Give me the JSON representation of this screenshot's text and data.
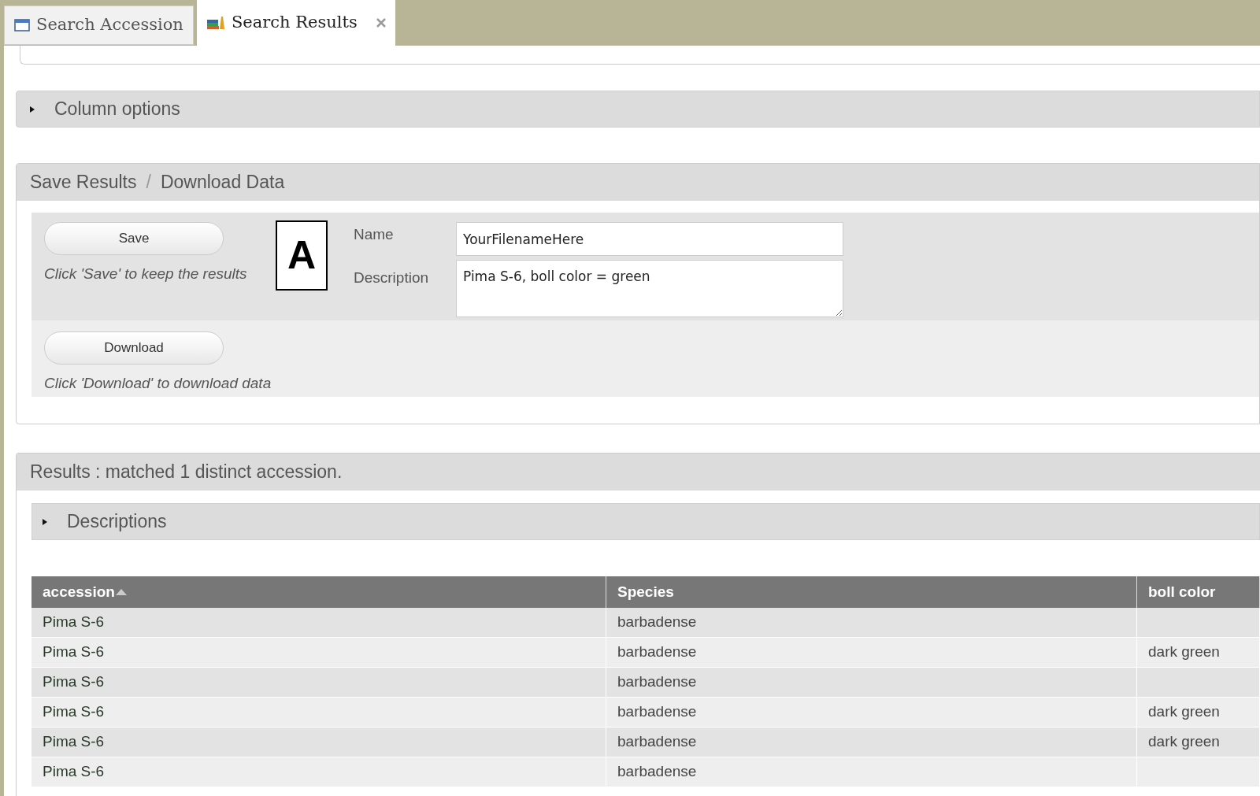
{
  "tabs": [
    {
      "label": "Search Accession",
      "kind": "window",
      "selected": false,
      "closable": false
    },
    {
      "label": "Search Results",
      "kind": "books",
      "selected": true,
      "closable": true
    }
  ],
  "column_options": {
    "title": "Column options",
    "expanded": false
  },
  "save_panel": {
    "title_parts": [
      "Save Results",
      "/",
      "Download Data"
    ],
    "save_button": "Save",
    "save_hint": "Click 'Save' to keep the results",
    "marker": "A",
    "name_label": "Name",
    "name_value": "YourFilenameHere",
    "description_label": "Description",
    "description_value": "Pima S-6, boll color = green",
    "download_button": "Download",
    "download_hint": "Click 'Download' to download data"
  },
  "results": {
    "title": "Results : matched 1 distinct accession.",
    "descriptions": {
      "title": "Descriptions",
      "expanded": false
    },
    "table": {
      "columns": [
        {
          "label": "accession",
          "sorted": true
        },
        {
          "label": "Species",
          "sorted": false
        },
        {
          "label": "boll color",
          "sorted": false
        }
      ],
      "rows": [
        [
          "Pima S-6",
          "barbadense",
          null
        ],
        [
          "Pima S-6",
          "barbadense",
          "dark green"
        ],
        [
          "Pima S-6",
          "barbadense",
          null
        ],
        [
          "Pima S-6",
          "barbadense",
          "dark green"
        ],
        [
          "Pima S-6",
          "barbadense",
          "dark green"
        ],
        [
          "Pima S-6",
          "barbadense",
          null
        ]
      ]
    }
  }
}
